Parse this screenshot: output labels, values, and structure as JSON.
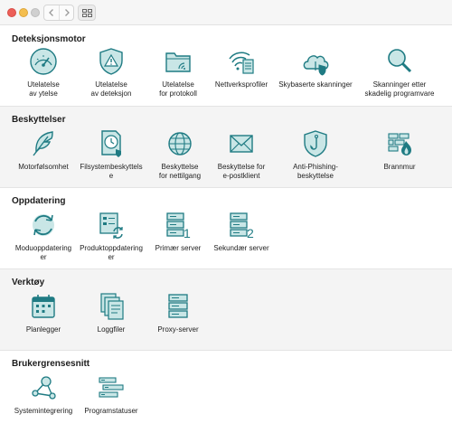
{
  "sections": [
    {
      "title": "Deteksjonsmotor",
      "items": [
        {
          "label": "Utelatelse\nav ytelse",
          "icon": "gauge-icon"
        },
        {
          "label": "Utelatelse\nav deteksjon",
          "icon": "shield-warning-icon"
        },
        {
          "label": "Utelatelse\nfor protokoll",
          "icon": "folder-wifi-icon"
        },
        {
          "label": "Nettverksprofiler",
          "icon": "network-profile-icon"
        },
        {
          "label": "Skybaserte skanninger",
          "icon": "cloud-shield-icon"
        },
        {
          "label": "Skanninger etter\nskadelig programvare",
          "icon": "magnifier-icon"
        }
      ]
    },
    {
      "title": "Beskyttelser",
      "items": [
        {
          "label": "Motorfølsomhet",
          "icon": "feather-icon"
        },
        {
          "label": "Filsystembeskyttels\ne",
          "icon": "file-clock-icon"
        },
        {
          "label": "Beskyttelse\nfor nettilgang",
          "icon": "globe-icon"
        },
        {
          "label": "Beskyttelse for\ne-postklient",
          "icon": "envelope-icon"
        },
        {
          "label": "Anti-Phishing-\nbeskyttelse",
          "icon": "fishhook-icon"
        },
        {
          "label": "Brannmur",
          "icon": "firewall-icon"
        }
      ]
    },
    {
      "title": "Oppdatering",
      "items": [
        {
          "label": "Moduoppdatering\ner",
          "icon": "refresh-icon"
        },
        {
          "label": "Produktoppdatering\ner",
          "icon": "product-update-icon"
        },
        {
          "label": "Primær server",
          "icon": "server-primary-icon",
          "badge": "1"
        },
        {
          "label": "Sekundær server",
          "icon": "server-secondary-icon",
          "badge": "2"
        }
      ]
    },
    {
      "title": "Verktøy",
      "items": [
        {
          "label": "Planlegger",
          "icon": "calendar-icon"
        },
        {
          "label": "Loggfiler",
          "icon": "log-files-icon"
        },
        {
          "label": "Proxy-server",
          "icon": "proxy-server-icon"
        }
      ]
    },
    {
      "title": "Brukergrensesnitt",
      "items": [
        {
          "label": "Systemintegrering",
          "icon": "integration-icon"
        },
        {
          "label": "Programstatuser",
          "icon": "status-list-icon"
        }
      ]
    }
  ],
  "colors": {
    "icon_fill": "#c9e6e6",
    "icon_stroke": "#1f7b83",
    "alt_bg": "#f4f4f4"
  }
}
